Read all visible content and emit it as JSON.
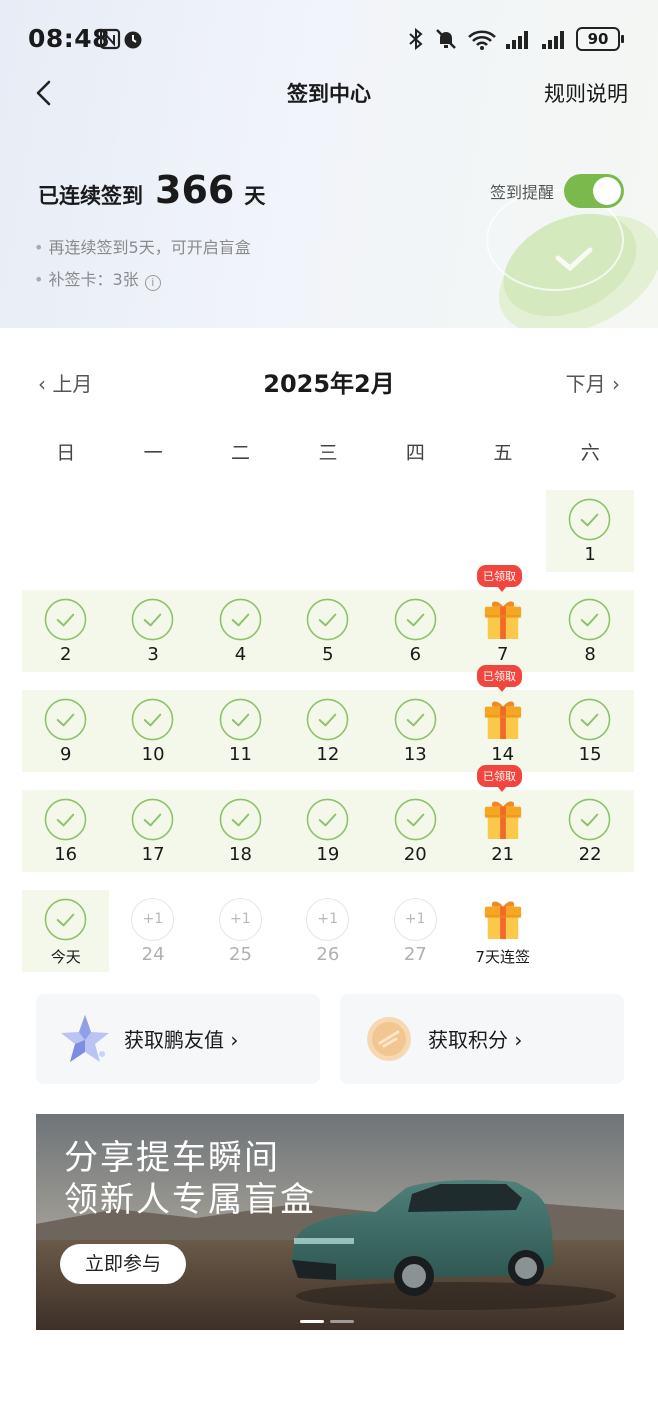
{
  "status_bar": {
    "time": "08:48",
    "battery": "90"
  },
  "nav": {
    "title": "签到中心",
    "rules": "规则说明"
  },
  "streak": {
    "label": "已连续签到",
    "days": "366",
    "unit": "天"
  },
  "reminder": {
    "label": "签到提醒",
    "enabled": true
  },
  "notes": {
    "line1": "再连续签到5天，可开启盲盒",
    "line2": "补签卡：3张"
  },
  "calendar": {
    "prev": "上月",
    "title": "2025年2月",
    "next": "下月",
    "weekdays": [
      "日",
      "一",
      "二",
      "三",
      "四",
      "五",
      "六"
    ],
    "claimed_badge": "已领取",
    "today_label": "今天",
    "plus_label": "+1",
    "streak_reward_label": "7天连签",
    "week1": {
      "d1": "1"
    },
    "week2": [
      "2",
      "3",
      "4",
      "5",
      "6",
      "7",
      "8"
    ],
    "week3": [
      "9",
      "10",
      "11",
      "12",
      "13",
      "14",
      "15"
    ],
    "week4": [
      "16",
      "17",
      "18",
      "19",
      "20",
      "21",
      "22"
    ],
    "week5": [
      "24",
      "25",
      "26",
      "27"
    ]
  },
  "cards": {
    "left": "获取鹏友值",
    "right": "获取积分"
  },
  "banner": {
    "line1": "分享提车瞬间",
    "line2": "领新人专属盲盒",
    "button": "立即参与"
  },
  "colors": {
    "accent_green": "#7aba4c",
    "badge_red": "#f2453d",
    "checked_bg": "#f3f8ea"
  }
}
